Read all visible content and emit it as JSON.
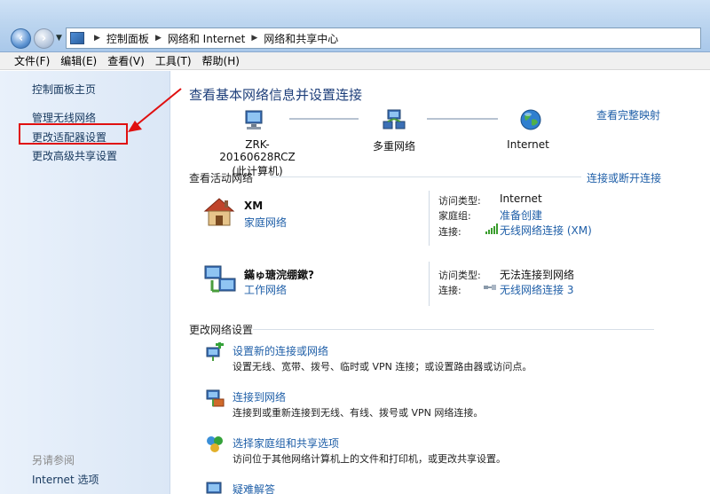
{
  "address": {
    "crumbs": [
      "控制面板",
      "网络和 Internet",
      "网络和共享中心"
    ]
  },
  "menu": [
    "文件(F)",
    "编辑(E)",
    "查看(V)",
    "工具(T)",
    "帮助(H)"
  ],
  "sidebar": {
    "home": "控制面板主页",
    "items": [
      "管理无线网络",
      "更改适配器设置",
      "更改高级共享设置"
    ],
    "see_also_title": "另请参阅",
    "see_also": [
      "Internet 选项"
    ]
  },
  "main": {
    "title": "查看基本网络信息并设置连接",
    "full_map_link": "查看完整映射",
    "nodes": {
      "computer_name": "ZRK-20160628RCZ",
      "computer_sub": "(此计算机)",
      "network": "多重网络",
      "internet": "Internet"
    },
    "active_title": "查看活动网络",
    "connect_disconnect": "连接或断开连接",
    "networks": [
      {
        "name": "XM",
        "type": "家庭网络",
        "access_label": "访问类型:",
        "access_value": "Internet",
        "homegroup_label": "家庭组:",
        "homegroup_value": "准备创建",
        "conn_label": "连接:",
        "conn_value": "无线网络连接 (XM)"
      },
      {
        "name": "鏋ゅ瑭浣绷鏉?",
        "type": "工作网络",
        "access_label": "访问类型:",
        "access_value": "无法连接到网络",
        "conn_label": "连接:",
        "conn_value": "无线网络连接 3"
      }
    ],
    "change_title": "更改网络设置",
    "tasks": [
      {
        "link": "设置新的连接或网络",
        "desc": "设置无线、宽带、拨号、临时或 VPN 连接；或设置路由器或访问点。"
      },
      {
        "link": "连接到网络",
        "desc": "连接到或重新连接到无线、有线、拨号或 VPN 网络连接。"
      },
      {
        "link": "选择家庭组和共享选项",
        "desc": "访问位于其他网络计算机上的文件和打印机，或更改共享设置。"
      },
      {
        "link": "疑难解答",
        "desc": ""
      }
    ]
  },
  "colors": {
    "link": "#1f5fa8",
    "highlight_box": "#e01010",
    "title": "#1e3f7a"
  }
}
